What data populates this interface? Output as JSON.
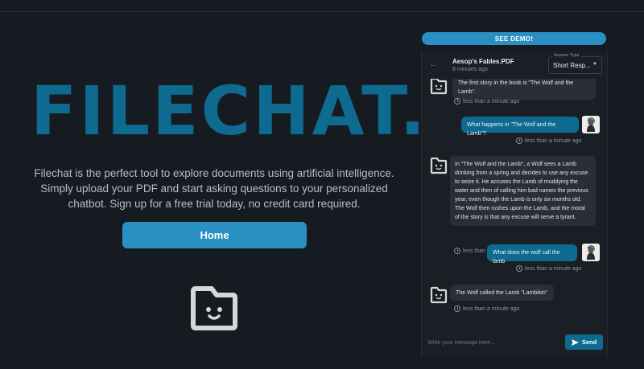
{
  "hero": {
    "title": "FILECHAT.IO",
    "description": "Filechat is the perfect tool to explore documents using artificial intelligence. Simply upload your PDF and start asking questions to your personalized chatbot. Sign up for a free trial today, no credit card required.",
    "home_label": "Home"
  },
  "demo": {
    "see_demo_label": "SEE DEMO!",
    "document_name": "Aesop's Fables.PDF",
    "document_time": "8 minutes ago",
    "answer_type_label": "Answer Type",
    "answer_type_value": "Short Resp...",
    "messages": [
      {
        "role": "bot",
        "text": "The first story in the book is \"The Wolf and the Lamb\".",
        "time": "less than a minute ago"
      },
      {
        "role": "user",
        "text": "What happens in \"The Wolf and the Lamb\"?",
        "time": "less than a minute ago"
      },
      {
        "role": "bot",
        "text": "In \"The Wolf and the Lamb\", a Wolf sees a Lamb drinking from a spring and decides to use any excuse to seize it. He accuses the Lamb of muddying the water and then of calling him bad names the previous year, even though the Lamb is only six months old. The Wolf then rushes upon the Lamb, and the moral of the story is that any excuse will serve a tyrant.",
        "time": "less than a minute ago"
      },
      {
        "role": "user",
        "text": "What does the wolf call the lamb",
        "time": "less than a minute ago"
      },
      {
        "role": "bot",
        "text": "The Wolf called the Lamb \"Lambikin\"",
        "time": "less than a minute ago"
      }
    ],
    "composer_placeholder": "Write your message here...",
    "send_label": "Send"
  },
  "colors": {
    "background": "#161b22",
    "accent": "#2a90c4",
    "brand_title": "#0e6a8e",
    "user_bubble": "#0e6a8e",
    "bot_bubble": "#2a2f36"
  }
}
